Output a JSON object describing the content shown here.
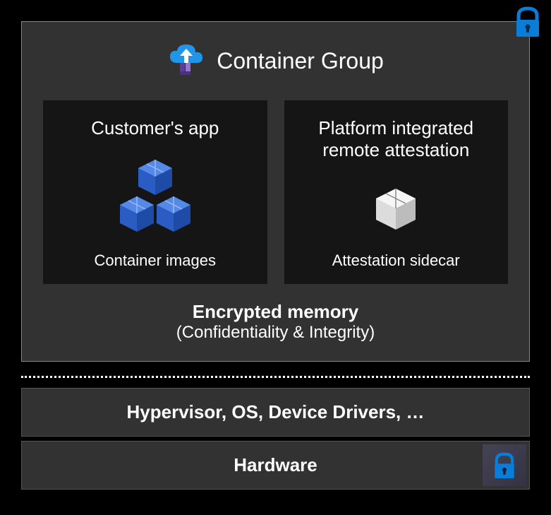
{
  "containerGroup": {
    "title": "Container Group",
    "customerApp": {
      "title": "Customer's app",
      "subtitle": "Container images"
    },
    "attestation": {
      "title": "Platform integrated remote attestation",
      "subtitle": "Attestation sidecar"
    },
    "memory": {
      "title": "Encrypted memory",
      "subtitle": "(Confidentiality & Integrity)"
    }
  },
  "layers": {
    "hypervisor": "Hypervisor, OS, Device Drivers, …",
    "hardware": "Hardware"
  },
  "icons": {
    "lock": "lock-icon",
    "cloud": "cloud-upload-icon",
    "box": "package-icon"
  }
}
